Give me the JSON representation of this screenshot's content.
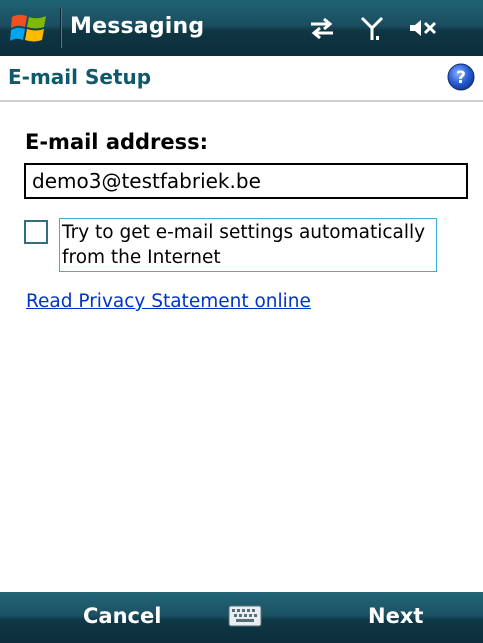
{
  "titlebar": {
    "app_title": "Messaging",
    "start_icon": "windows-flag-icon",
    "status_icons": [
      "connectivity-arrows-icon",
      "signal-antenna-icon",
      "volume-muted-icon"
    ]
  },
  "header": {
    "title": "E-mail Setup",
    "help_icon": "help-icon"
  },
  "form": {
    "email_label": "E-mail address:",
    "email_value": "demo3@testfabriek.be",
    "auto_settings_checked": false,
    "auto_settings_label": "Try to get e-mail settings automatically from the Internet",
    "privacy_link": "Read Privacy Statement online"
  },
  "softkeys": {
    "left_label": "Cancel",
    "center_icon": "keyboard-icon",
    "right_label": "Next"
  },
  "colors": {
    "title_bar": "#1a4e5f",
    "header_text": "#0e5a6c",
    "link": "#0033cc"
  }
}
